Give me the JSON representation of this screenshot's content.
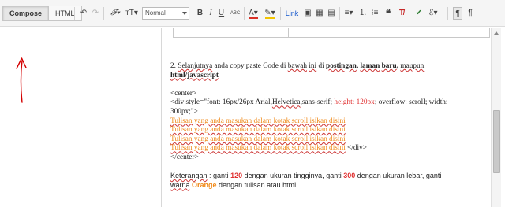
{
  "toolbar": {
    "compose_label": "Compose",
    "html_label": "HTML",
    "font_size_value": "Normal",
    "link_label": "Link",
    "text_color": "#d93025",
    "highlight_color": "#f2c400"
  },
  "editor": {
    "step_line": {
      "a": "2. ",
      "b": "Selanjutnya",
      "c": " anda copy paste  Code di ",
      "d": "bawah",
      "e": " ",
      "f": "ini",
      "g": " di ",
      "h": "postingan",
      "i": ", ",
      "j": "laman",
      "k": " ",
      "l": "baru",
      "m": ", ",
      "n": "maupun"
    },
    "step_line2": "html/javascript",
    "code_center_open": "<center>",
    "code_div_a": "<div style=\"font: 16px/26px Arial,",
    "code_div_b": "Helvetica",
    "code_div_c": ",sans-serif; ",
    "code_div_red": "height: 120px",
    "code_div_d": "; overflow: scroll; width:",
    "code_div_line2": "300px;\">",
    "sample_line": "Tulisan yang anda masukan dalam kotak scroll isikan disini",
    "div_close": " </div>",
    "center_close": "</center>",
    "note": {
      "a": "Keterangan",
      "b": " : ganti ",
      "num1": "120",
      "c": " dengan ukuran tingginya, ganti ",
      "num2": "300",
      "d": " dengan ukuran lebar, ganti",
      "e": "warna",
      "f": " ",
      "orange": "Orange",
      "g": " dengan tulisan atau html"
    }
  },
  "colors": {
    "accent_red": "#e03030",
    "accent_orange": "#f08a1a",
    "annotation_red": "#d40000"
  }
}
